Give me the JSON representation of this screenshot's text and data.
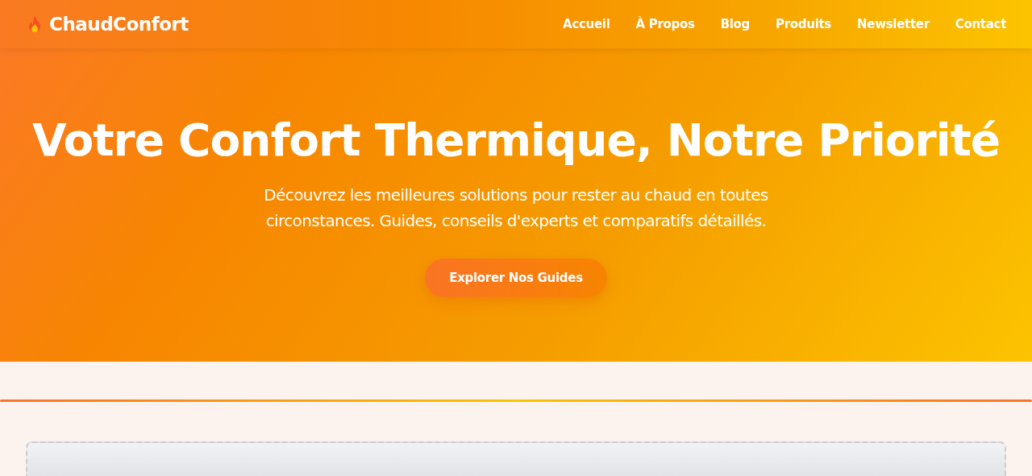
{
  "header": {
    "brand": "ChaudConfort",
    "nav": [
      "Accueil",
      "À Propos",
      "Blog",
      "Produits",
      "Newsletter",
      "Contact"
    ]
  },
  "hero": {
    "title": "Votre Confort Thermique, Notre Priorité",
    "subtitle": "Découvrez les meilleures solutions pour rester au chaud en toutes circonstances. Guides, conseils d'experts et comparatifs détaillés.",
    "button": "Explorer Nos Guides"
  }
}
